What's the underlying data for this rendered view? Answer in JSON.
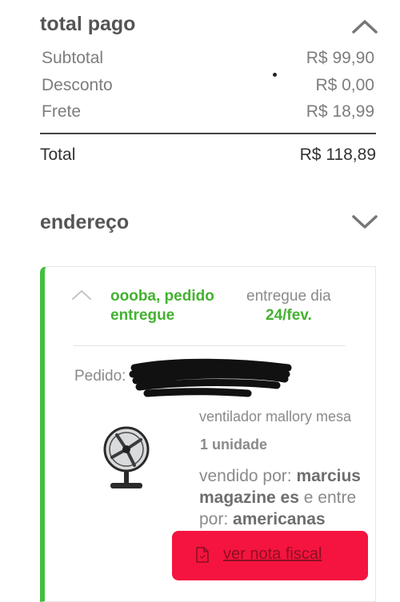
{
  "summary": {
    "title": "total pago",
    "rows": [
      {
        "label": "Subtotal",
        "value": "R$ 99,90"
      },
      {
        "label": "Desconto",
        "value": "R$ 0,00"
      },
      {
        "label": "Frete",
        "value": "R$ 18,99"
      }
    ],
    "total_label": "Total",
    "total_value": "R$ 118,89"
  },
  "address": {
    "title": "endereço"
  },
  "order": {
    "status_line1": "oooba, pedido",
    "status_line2": "entregue",
    "delivered_label": "entregue dia",
    "delivered_date": "24/fev.",
    "order_label": "Pedido:",
    "product_name": "ventilador mallory mesa",
    "quantity": "1 unidade",
    "sold_by_label": "vendido por:",
    "seller": "marcius",
    "seller_line2": "magazine es",
    "delivered_by_label": "e entre",
    "by_label": "por:",
    "carrier": "americanas",
    "invoice_button": "ver nota fiscal"
  },
  "colors": {
    "accent_green": "#43b22f",
    "button_red": "#f5143f"
  }
}
